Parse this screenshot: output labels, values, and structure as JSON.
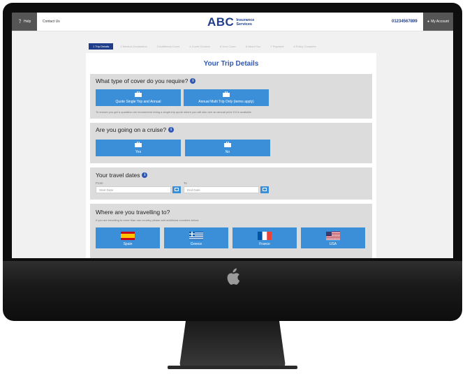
{
  "header": {
    "help_label": "Help",
    "contact_label": "Contact Us",
    "logo_abc": "ABC",
    "logo_sub_line1": "Insurance",
    "logo_sub_line2": "Services",
    "phone": "01234567899",
    "account_label": "My Account"
  },
  "steps": [
    "1 Trip Details",
    "2 Medical Declaration",
    "3 Additional Cover",
    "4 Cover Choices",
    "5 Your Cover",
    "6 About You",
    "7 Payment",
    "8 Policy Complete"
  ],
  "page_title": "Your Trip Details",
  "cover": {
    "question": "What type of cover do you require?",
    "option_single": "Quote Single Trip and Annual",
    "option_annual": "Annual Multi Trip Only (terms apply)",
    "note": "To ensure you get a quotation we recommend doing a single-trip quote where you will also see an annual price if it is available"
  },
  "cruise": {
    "question": "Are you going on a cruise?",
    "yes": "Yes",
    "no": "No"
  },
  "dates": {
    "title": "Your travel dates",
    "from_label": "From",
    "to_label": "To",
    "start_placeholder": "Start Date",
    "end_placeholder": "End Date"
  },
  "destination": {
    "title": "Where are you travelling to?",
    "note": "If you are travelling to more than one country please add additional countries below.",
    "countries": [
      "Spain",
      "Greece",
      "France",
      "USA"
    ]
  },
  "colors": {
    "brand_navy": "#1f3d8a",
    "button_blue": "#3b8fd8",
    "title_blue": "#2f57b3",
    "section_grey": "#dcdcdc"
  }
}
